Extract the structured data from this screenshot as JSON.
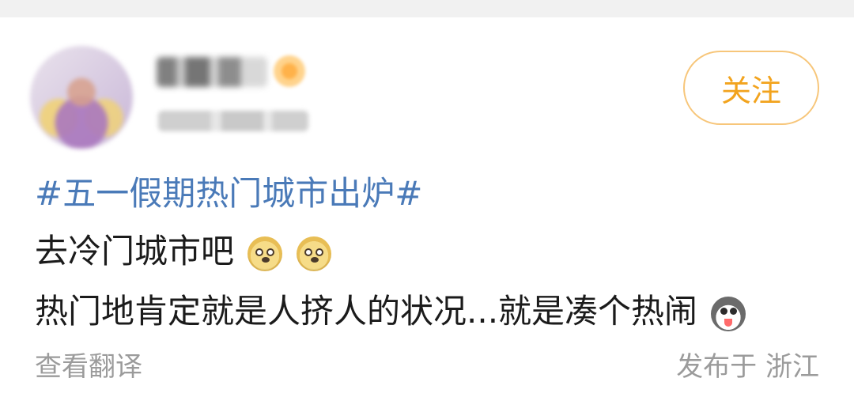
{
  "post": {
    "follow_label": "关注",
    "hashtag": "#五一假期热门城市出炉#",
    "line1": "去冷门城市吧",
    "line2": "热门地肯定就是人挤人的状况...就是凑个热闹",
    "translate_label": "查看翻译",
    "location_label": "发布于 浙江"
  },
  "icons": {
    "doge": "doge-emoji-icon",
    "husky": "husky-emoji-icon"
  },
  "colors": {
    "hashtag": "#4a7ab8",
    "follow": "#f2a31d",
    "meta": "#9b9b9b"
  }
}
